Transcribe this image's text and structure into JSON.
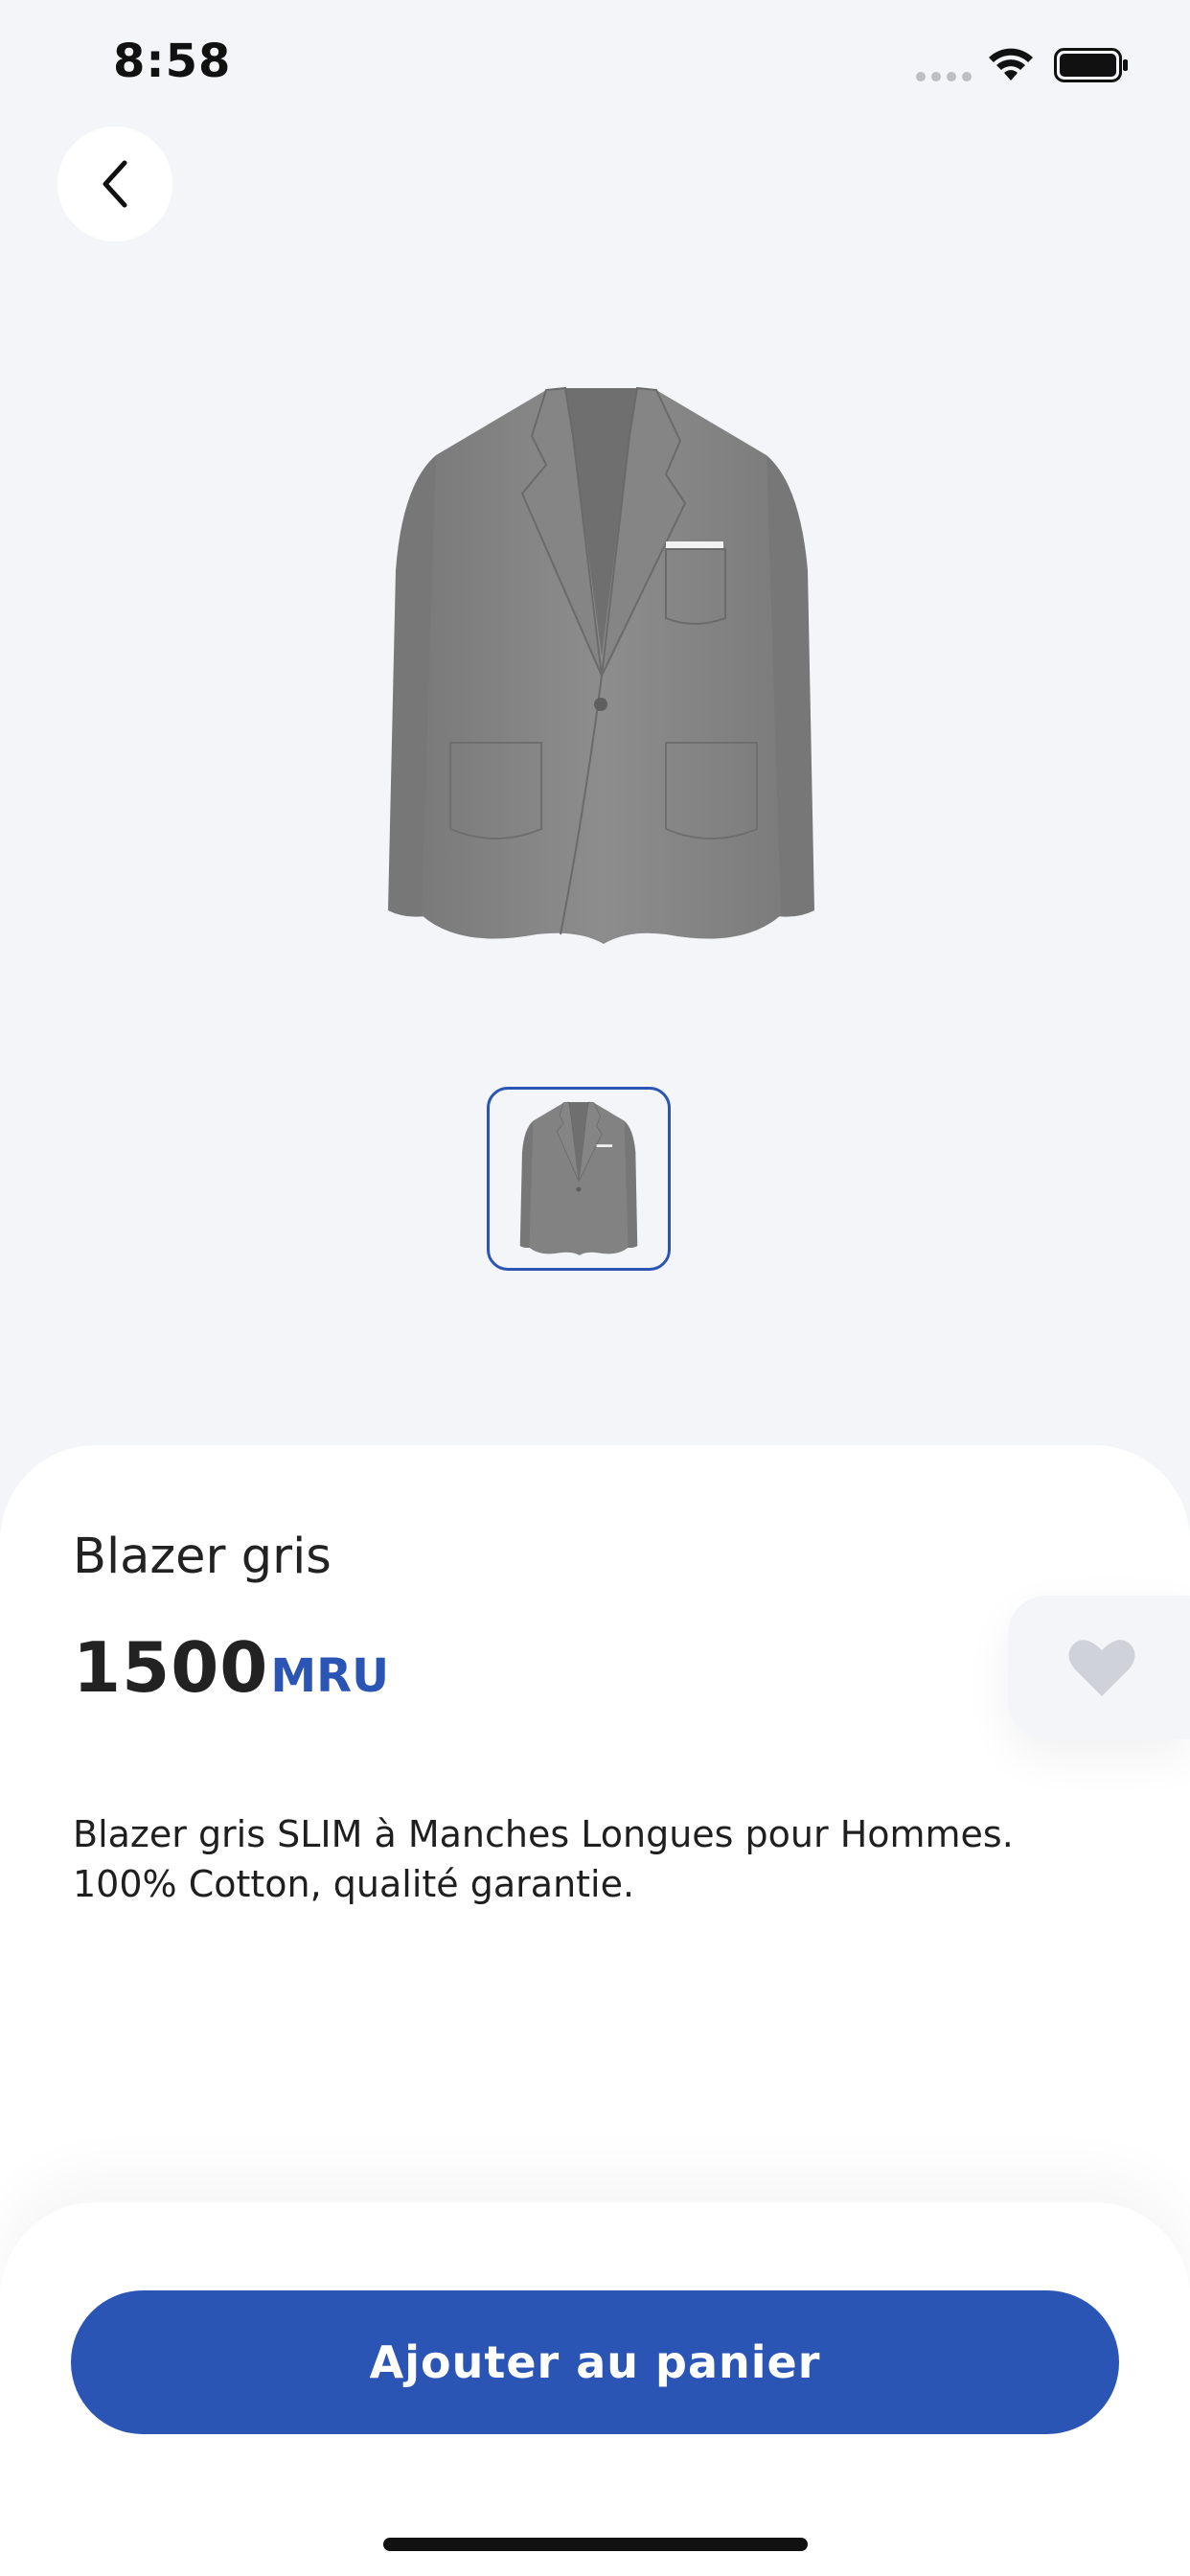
{
  "status_bar": {
    "time": "8:58"
  },
  "navigation": {
    "back_icon": "chevron-left-icon"
  },
  "product": {
    "name": "Blazer gris",
    "price": "1500",
    "currency": "MRU",
    "description": "Blazer gris SLIM à Manches Longues pour Hommes. 100% Cotton, qualité garantie.",
    "favorite_icon": "heart-icon"
  },
  "actions": {
    "add_to_cart_label": "Ajouter au panier"
  },
  "colors": {
    "accent": "#2a55b5",
    "background": "#f4f5f9",
    "favorite_icon_color": "#cfd2d9"
  }
}
